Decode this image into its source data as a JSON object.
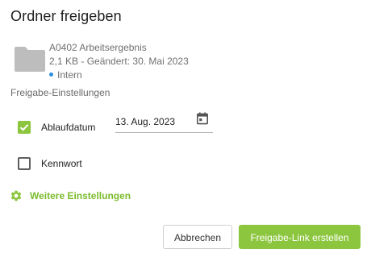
{
  "dialog": {
    "title": "Ordner freigeben"
  },
  "file": {
    "icon": "folder-icon",
    "name": "A0402 Arbeitsergebnis",
    "meta": "2,1 KB - Geändert: 30. Mai 2023",
    "classification": "Intern",
    "classification_color": "#2a8fe0"
  },
  "settings": {
    "section_label": "Freigabe-Einstellungen",
    "expiry": {
      "label": "Ablaufdatum",
      "checked": true,
      "date_value": "13. Aug. 2023"
    },
    "password": {
      "label": "Kennwort",
      "checked": false
    },
    "more_label": "Weitere Einstellungen"
  },
  "buttons": {
    "cancel_label": "Abbrechen",
    "create_label": "Freigabe-Link erstellen"
  },
  "colors": {
    "accent": "#8cc63e",
    "accent_text": "#7bbb2c"
  }
}
